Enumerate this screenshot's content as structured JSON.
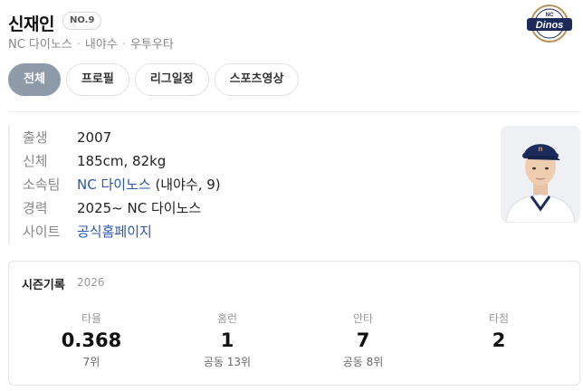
{
  "player": {
    "name": "신재인",
    "number": "NO.9",
    "team": "NC 다이노스",
    "position": "내야수",
    "hand": "우투우타"
  },
  "logo": {
    "icon": "nc-dinos-logo",
    "text": "Dinos",
    "small_text": "NC",
    "colors": {
      "navy": "#1d2b5a",
      "gold": "#b8945a"
    }
  },
  "tabs": [
    {
      "label": "전체",
      "active": true
    },
    {
      "label": "프로필",
      "active": false
    },
    {
      "label": "리그일정",
      "active": false
    },
    {
      "label": "스포츠영상",
      "active": false
    }
  ],
  "profile": {
    "birth": {
      "label": "출생",
      "value": "2007"
    },
    "body": {
      "label": "신체",
      "value": "185cm, 82kg"
    },
    "team": {
      "label": "소속팀",
      "link": "NC 다이노스",
      "value": " (내야수, 9)"
    },
    "career": {
      "label": "경력",
      "value": "2025~ NC 다이노스"
    },
    "site": {
      "label": "사이트",
      "link": "공식홈페이지"
    }
  },
  "season": {
    "title": "시즌기록",
    "year": "2026",
    "stats": [
      {
        "label": "타율",
        "value": "0.368",
        "rank": "7위"
      },
      {
        "label": "홈런",
        "value": "1",
        "rank": "공동 13위"
      },
      {
        "label": "안타",
        "value": "7",
        "rank": "공동 8위"
      },
      {
        "label": "타점",
        "value": "2",
        "rank": ""
      }
    ]
  }
}
